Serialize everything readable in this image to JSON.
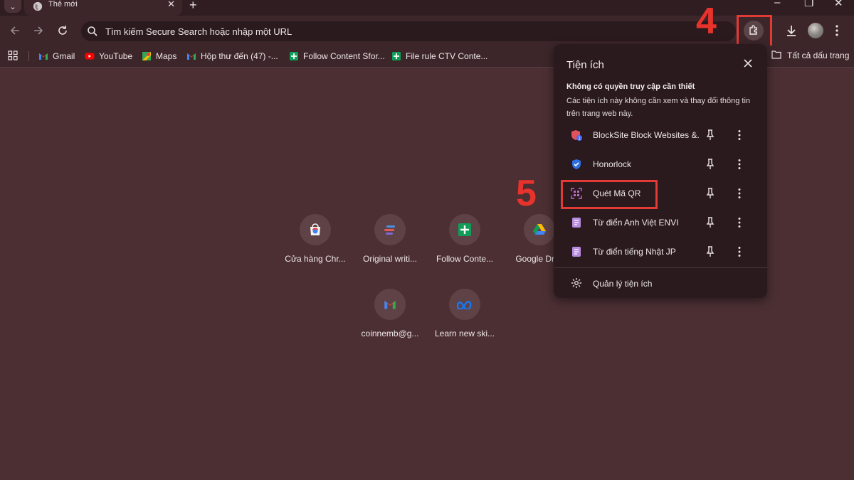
{
  "tab": {
    "title": "Thẻ mới"
  },
  "omnibox": {
    "text": "Tìm kiếm Secure Search hoặc nhập một URL"
  },
  "bookmarks": [
    {
      "label": "Gmail",
      "icon": "gmail-icon"
    },
    {
      "label": "YouTube",
      "icon": "youtube-icon"
    },
    {
      "label": "Maps",
      "icon": "maps-icon"
    },
    {
      "label": "Hộp thư đến (47) -...",
      "icon": "gmail-icon"
    },
    {
      "label": "Follow Content Sfor...",
      "icon": "sheets-icon"
    },
    {
      "label": "File rule CTV Conte...",
      "icon": "sheets-icon"
    }
  ],
  "bookmarks_all": "Tất cả dấu trang",
  "shortcuts": [
    {
      "label": "Cửa hàng Chr..."
    },
    {
      "label": "Original writi..."
    },
    {
      "label": "Follow Conte..."
    },
    {
      "label": "Google Dri..."
    },
    {
      "label": "coinnemb@g..."
    },
    {
      "label": "Learn new ski..."
    }
  ],
  "extensions_panel": {
    "title": "Tiện ích",
    "section_head": "Không có quyền truy cập cần thiết",
    "section_desc": "Các tiện ích này không cần xem và thay đổi thông tin trên trang web này.",
    "items": [
      {
        "name": "BlockSite Block Websites &...",
        "icon": "blocksite-icon"
      },
      {
        "name": "Honorlock",
        "icon": "honorlock-icon"
      },
      {
        "name": "Quét Mã QR",
        "icon": "qr-scan-icon"
      },
      {
        "name": "Từ điển Anh Việt ENVI",
        "icon": "dictionary-icon"
      },
      {
        "name": "Từ điển tiếng Nhật JP",
        "icon": "dictionary-icon"
      }
    ],
    "manage_label": "Quản lý tiện ích"
  },
  "annotations": {
    "step4": "4",
    "step5": "5",
    "highlight_color": "#e23a34"
  }
}
